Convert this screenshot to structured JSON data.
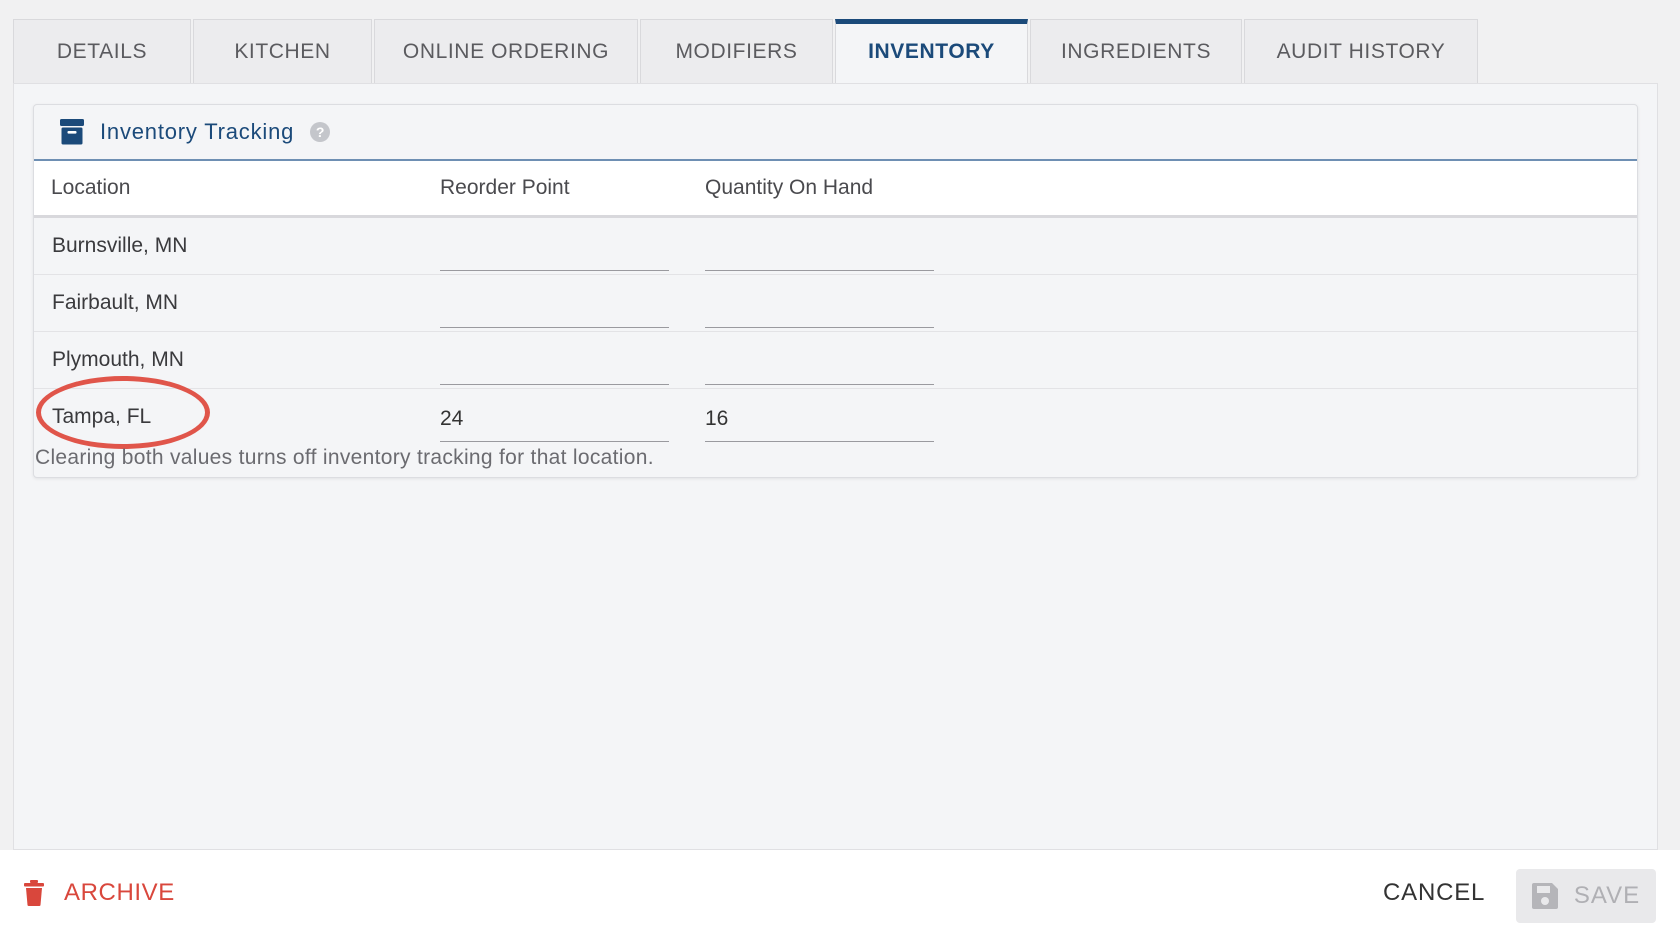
{
  "tabs": [
    {
      "label": "DETAILS",
      "active": false
    },
    {
      "label": "KITCHEN",
      "active": false
    },
    {
      "label": "ONLINE ORDERING",
      "active": false
    },
    {
      "label": "MODIFIERS",
      "active": false
    },
    {
      "label": "INVENTORY",
      "active": true
    },
    {
      "label": "INGREDIENTS",
      "active": false
    },
    {
      "label": "AUDIT HISTORY",
      "active": false
    }
  ],
  "inventory": {
    "title": "Inventory Tracking",
    "help_glyph": "?",
    "columns": {
      "location": "Location",
      "reorder_point": "Reorder Point",
      "quantity_on_hand": "Quantity On Hand"
    },
    "rows": [
      {
        "location": "Burnsville, MN",
        "reorder_point": "",
        "quantity_on_hand": ""
      },
      {
        "location": "Fairbault, MN",
        "reorder_point": "",
        "quantity_on_hand": ""
      },
      {
        "location": "Plymouth, MN",
        "reorder_point": "",
        "quantity_on_hand": ""
      },
      {
        "location": "Tampa, FL",
        "reorder_point": "24",
        "quantity_on_hand": "16",
        "highlighted": true
      }
    ],
    "footnote": "Clearing both values turns off inventory tracking for that location."
  },
  "footer": {
    "archive_label": "ARCHIVE",
    "cancel_label": "CANCEL",
    "save_label": "SAVE",
    "save_disabled": true
  },
  "colors": {
    "accent": "#1b4a7a",
    "danger": "#d9473c",
    "highlight_ring": "#e0554a"
  }
}
